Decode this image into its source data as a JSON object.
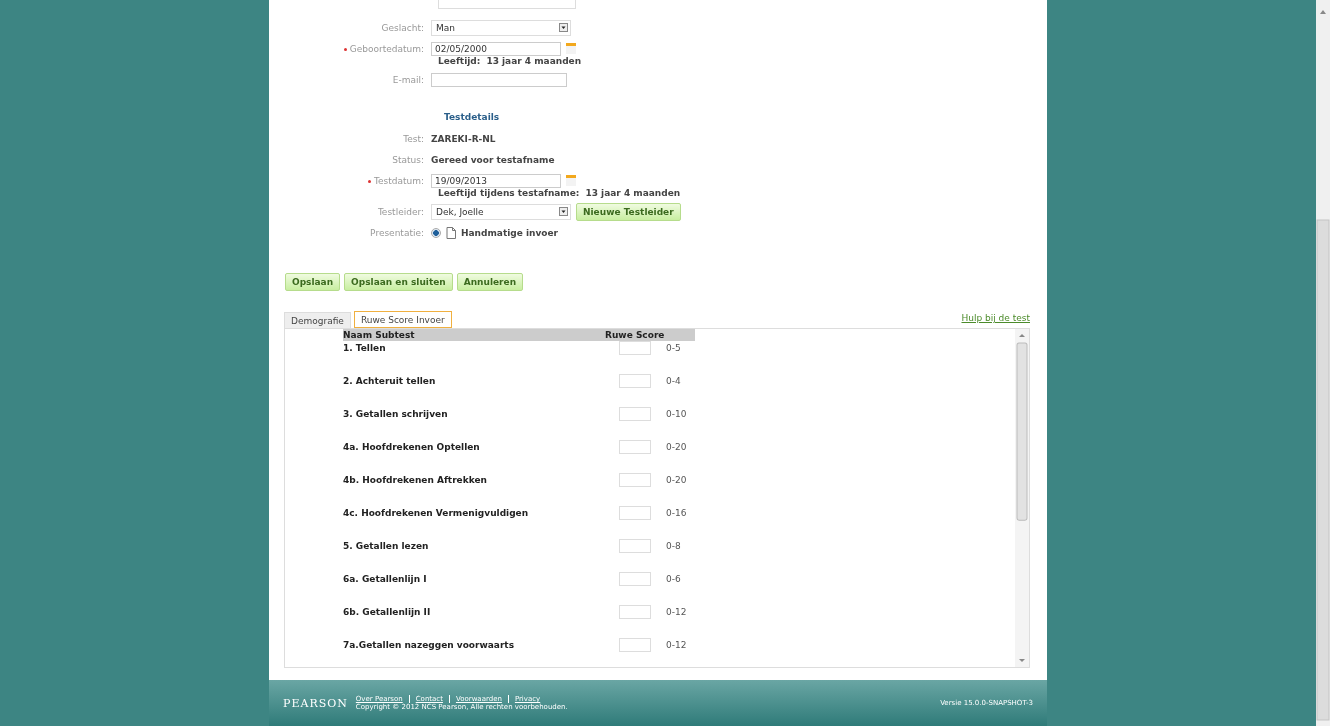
{
  "form": {
    "fields": [
      {
        "kind": "select",
        "label": "Geslacht:",
        "value": "Man",
        "required": false
      },
      {
        "kind": "date",
        "label": "Geboortedatum:",
        "value": "02/05/2000",
        "required": true,
        "note_label": "Leeftijd:",
        "note_value": "13 jaar 4 maanden"
      },
      {
        "kind": "text",
        "label": "E-mail:",
        "required": false
      }
    ],
    "section_title": "Testdetails",
    "details": [
      {
        "kind": "info",
        "label": "Test:",
        "value": "ZAREKI-R-NL",
        "required": false
      },
      {
        "kind": "info",
        "label": "Status:",
        "value": "Gereed voor testafname",
        "required": false
      },
      {
        "kind": "date",
        "label": "Testdatum:",
        "value": "19/09/2013",
        "required": true,
        "note_label": "Leeftijd tijdens testafname:",
        "note_value": "13 jaar 4 maanden"
      },
      {
        "kind": "select",
        "label": "Testleider:",
        "value": "Dek, Joelle",
        "required": false,
        "button": "Nieuwe Testleider"
      },
      {
        "kind": "radio",
        "label": "Presentatie:",
        "value": "Handmatige invoer",
        "selected": true,
        "required": false
      }
    ]
  },
  "actions": [
    "Opslaan",
    "Opslaan en sluiten",
    "Annuleren"
  ],
  "tabs": [
    {
      "label": "Demografie",
      "selected": false
    },
    {
      "label": "Ruwe Score Invoer",
      "selected": true
    }
  ],
  "help_link": "Hulp bij de test",
  "table": {
    "columns": [
      "Naam Subtest",
      "Ruwe Score"
    ],
    "rows": [
      {
        "name": "1. Tellen",
        "range": "0-5"
      },
      {
        "name": "2. Achteruit tellen",
        "range": "0-4"
      },
      {
        "name": "3. Getallen schrijven",
        "range": "0-10"
      },
      {
        "name": "4a. Hoofdrekenen Optellen",
        "range": "0-20"
      },
      {
        "name": "4b. Hoofdrekenen Aftrekken",
        "range": "0-20"
      },
      {
        "name": "4c. Hoofdrekenen Vermenigvuldigen",
        "range": "0-16"
      },
      {
        "name": "5. Getallen lezen",
        "range": "0-8"
      },
      {
        "name": "6a. Getallenlijn I",
        "range": "0-6"
      },
      {
        "name": "6b. Getallenlijn II",
        "range": "0-12"
      },
      {
        "name": "7a.Getallen nazeggen voorwaarts",
        "range": "0-12"
      }
    ]
  },
  "footer": {
    "logo": "PEARSON",
    "links": [
      "Over Pearson",
      "Contact",
      "Voorwaarden",
      "Privacy"
    ],
    "copyright": "Copyright © 2012 NCS Pearson, Alle rechten voorbehouden.",
    "version": "Versie 15.0.0-SNAPSHOT-3"
  }
}
